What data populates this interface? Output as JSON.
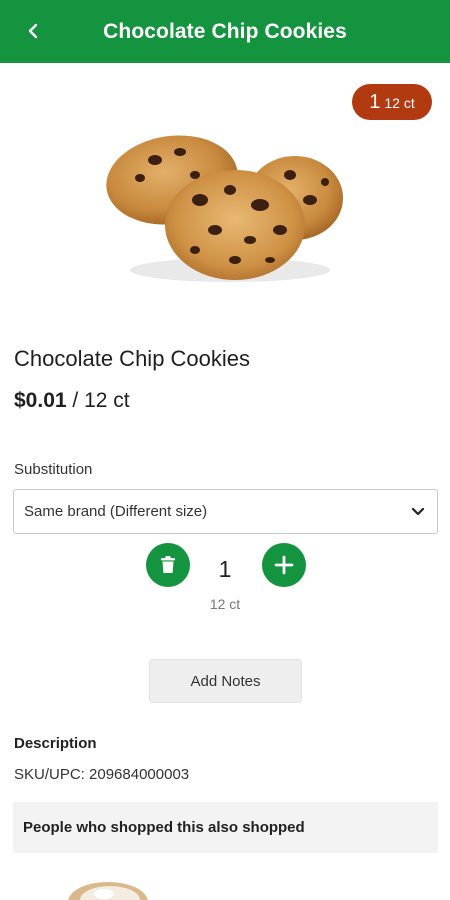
{
  "header": {
    "title": "Chocolate Chip Cookies",
    "back_icon": "chevron-left-icon",
    "background": "#14943f"
  },
  "cart_badge": {
    "quantity": "1",
    "unit": "12 ct",
    "color": "#b23a10"
  },
  "product": {
    "name": "Chocolate Chip Cookies",
    "price": "$0.01",
    "price_suffix": " / 12 ct",
    "image": "chocolate-chip-cookies-photo"
  },
  "substitution": {
    "label": "Substitution",
    "selected": "Same brand (Different size)",
    "icon": "chevron-down-icon"
  },
  "quantity_control": {
    "value": "1",
    "unit": "12 ct",
    "delete_icon": "trash-icon",
    "add_icon": "plus-icon"
  },
  "notes": {
    "button_label": "Add Notes"
  },
  "description": {
    "heading": "Description",
    "sku_line": "SKU/UPC: 209684000003"
  },
  "related": {
    "heading": "People who shopped this also shopped"
  }
}
